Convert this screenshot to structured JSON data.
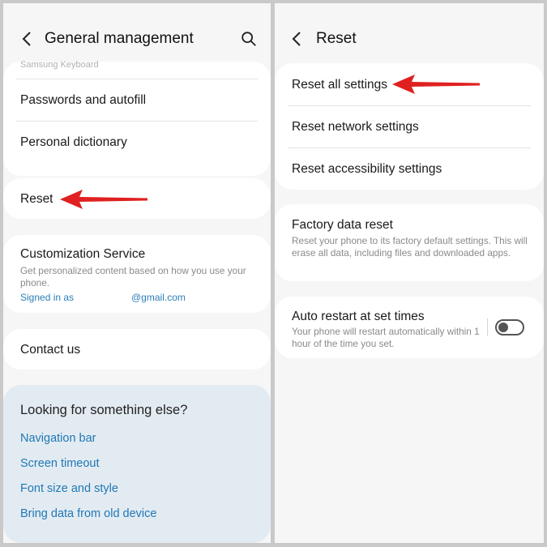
{
  "left": {
    "header": {
      "title": "General management"
    },
    "items": {
      "samsung_keyboard": "Samsung Keyboard",
      "passwords": "Passwords and autofill",
      "dictionary": "Personal dictionary",
      "reset": "Reset",
      "customization_title": "Customization Service",
      "customization_desc": "Get personalized content based on how you use your phone.",
      "signed_in_label": "Signed in as",
      "signed_in_email": "@gmail.com",
      "contact": "Contact us"
    },
    "suggestions": {
      "title": "Looking for something else?",
      "links": [
        "Navigation bar",
        "Screen timeout",
        "Font size and style",
        "Bring data from old device"
      ]
    }
  },
  "right": {
    "header": {
      "title": "Reset"
    },
    "items": {
      "reset_all": "Reset all settings",
      "reset_network": "Reset network settings",
      "reset_accessibility": "Reset accessibility settings",
      "factory_title": "Factory data reset",
      "factory_desc": "Reset your phone to its factory default settings. This will erase all data, including files and downloaded apps.",
      "auto_restart_title": "Auto restart at set times",
      "auto_restart_desc": "Your phone will restart automatically within 1 hour of the time you set."
    },
    "auto_restart_toggle": "off"
  },
  "annotation_color": "#e02020"
}
